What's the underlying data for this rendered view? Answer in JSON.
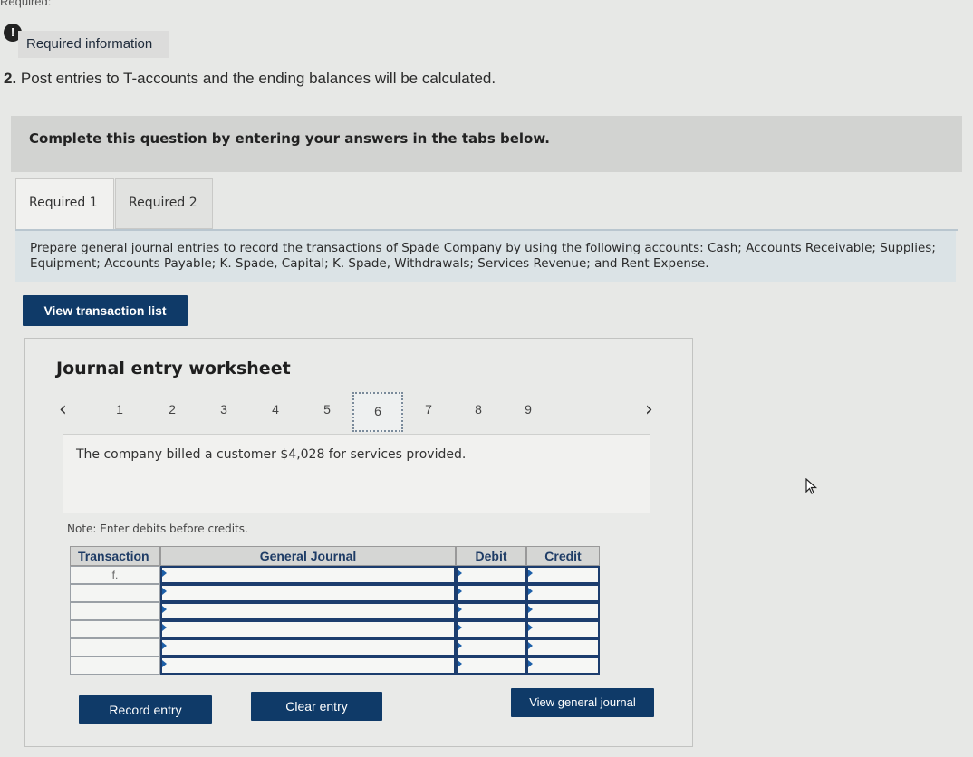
{
  "header": {
    "cut_text": "Required:",
    "alert_icon": "!",
    "required_info": "Required information",
    "question_number": "2.",
    "question_text": "Post entries to T-accounts and the ending balances will be calculated."
  },
  "complete_bar": "Complete this question by entering your answers in the tabs below.",
  "tabs": [
    {
      "label": "Required 1",
      "active": true
    },
    {
      "label": "Required 2",
      "active": false
    }
  ],
  "instructions": "Prepare general journal entries to record the transactions of Spade Company by using the following accounts: Cash; Accounts Receivable; Supplies; Equipment; Accounts Payable; K. Spade, Capital; K. Spade, Withdrawals; Services Revenue; and Rent Expense.",
  "view_transaction_list": "View transaction list",
  "worksheet": {
    "title": "Journal entry worksheet",
    "prev_icon": "chevron-left-icon",
    "next_icon": "chevron-right-icon",
    "pages": [
      "1",
      "2",
      "3",
      "4",
      "5",
      "6",
      "7",
      "8",
      "9"
    ],
    "active_page": "6",
    "description": "The company billed a customer $4,028 for services provided.",
    "note": "Note: Enter debits before credits.",
    "table": {
      "headers": {
        "transaction": "Transaction",
        "general_journal": "General Journal",
        "debit": "Debit",
        "credit": "Credit"
      },
      "rows": [
        {
          "transaction": "f.",
          "account": "",
          "debit": "",
          "credit": ""
        },
        {
          "transaction": "",
          "account": "",
          "debit": "",
          "credit": ""
        },
        {
          "transaction": "",
          "account": "",
          "debit": "",
          "credit": ""
        },
        {
          "transaction": "",
          "account": "",
          "debit": "",
          "credit": ""
        },
        {
          "transaction": "",
          "account": "",
          "debit": "",
          "credit": ""
        },
        {
          "transaction": "",
          "account": "",
          "debit": "",
          "credit": ""
        }
      ]
    },
    "buttons": {
      "record": "Record entry",
      "clear": "Clear entry",
      "view_general": "View general journal"
    }
  },
  "colors": {
    "button_bg": "#0f3a68",
    "input_border": "#1c3d6e",
    "header_text": "#1e3c66"
  }
}
